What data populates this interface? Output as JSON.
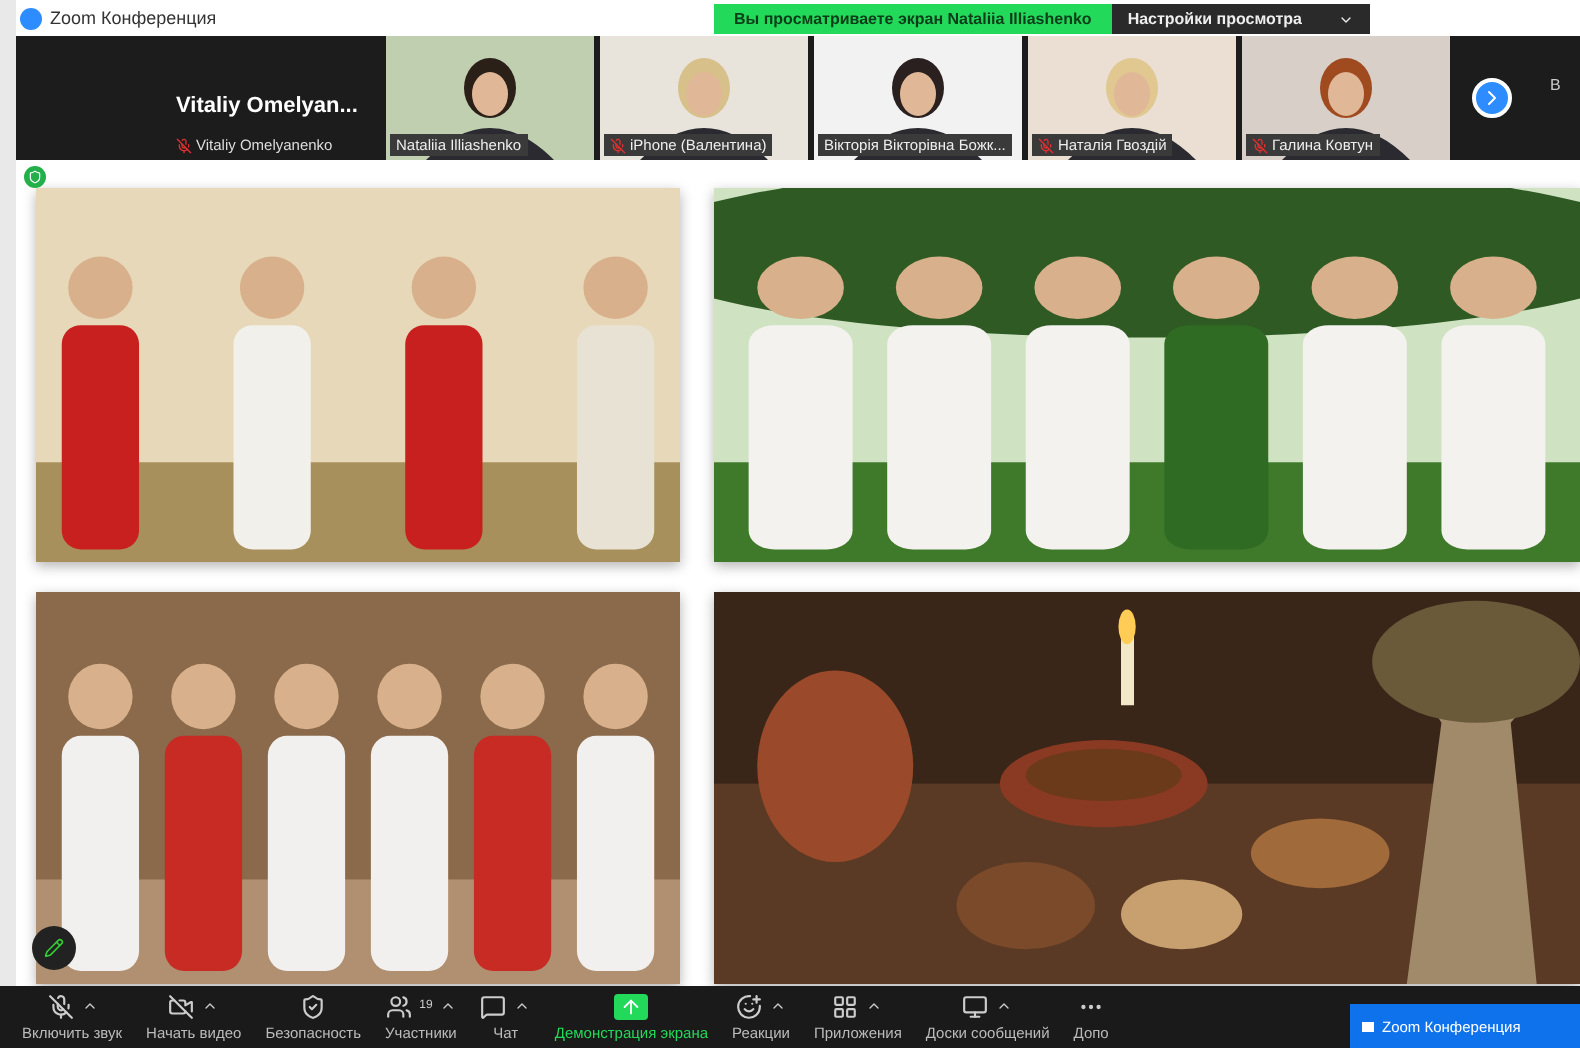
{
  "window": {
    "title": "Zoom Конференция"
  },
  "share_banner": {
    "text": "Вы просматриваете экран Nataliia Illiashenko"
  },
  "view_options": {
    "label": "Настройки просмотра"
  },
  "active_speaker": {
    "display_name": "Vitaliy  Omelyan...",
    "label": "Vitaliy Omelyanenko",
    "muted": true
  },
  "tiles": [
    {
      "name": "Nataliia Illiashenko",
      "muted": false
    },
    {
      "name": "iPhone (Валентина)",
      "muted": true
    },
    {
      "name": "Вікторія Вікторівна Божк...",
      "muted": false
    },
    {
      "name": "Наталія Гвоздій",
      "muted": true
    },
    {
      "name": "Галина Ковтун",
      "muted": true
    }
  ],
  "gallery_side_label": "В",
  "toolbar": [
    {
      "kind": "mic",
      "label": "Включить звук",
      "crossed": true,
      "caret": true
    },
    {
      "kind": "video",
      "label": "Начать видео",
      "crossed": true,
      "caret": true
    },
    {
      "kind": "shield",
      "label": "Безопасность",
      "caret": false
    },
    {
      "kind": "people",
      "label": "Участники",
      "count": "19",
      "caret": true
    },
    {
      "kind": "chat",
      "label": "Чат",
      "caret": true
    },
    {
      "kind": "share",
      "label": "Демонстрация экрана",
      "active": true,
      "caret": false
    },
    {
      "kind": "reaction",
      "label": "Реакции",
      "caret": true
    },
    {
      "kind": "apps",
      "label": "Приложения",
      "caret": true
    },
    {
      "kind": "board",
      "label": "Доски сообщений",
      "caret": true
    },
    {
      "kind": "more",
      "label": "Допо",
      "caret": false
    }
  ],
  "notification": {
    "text": "Zoom Конференция"
  }
}
